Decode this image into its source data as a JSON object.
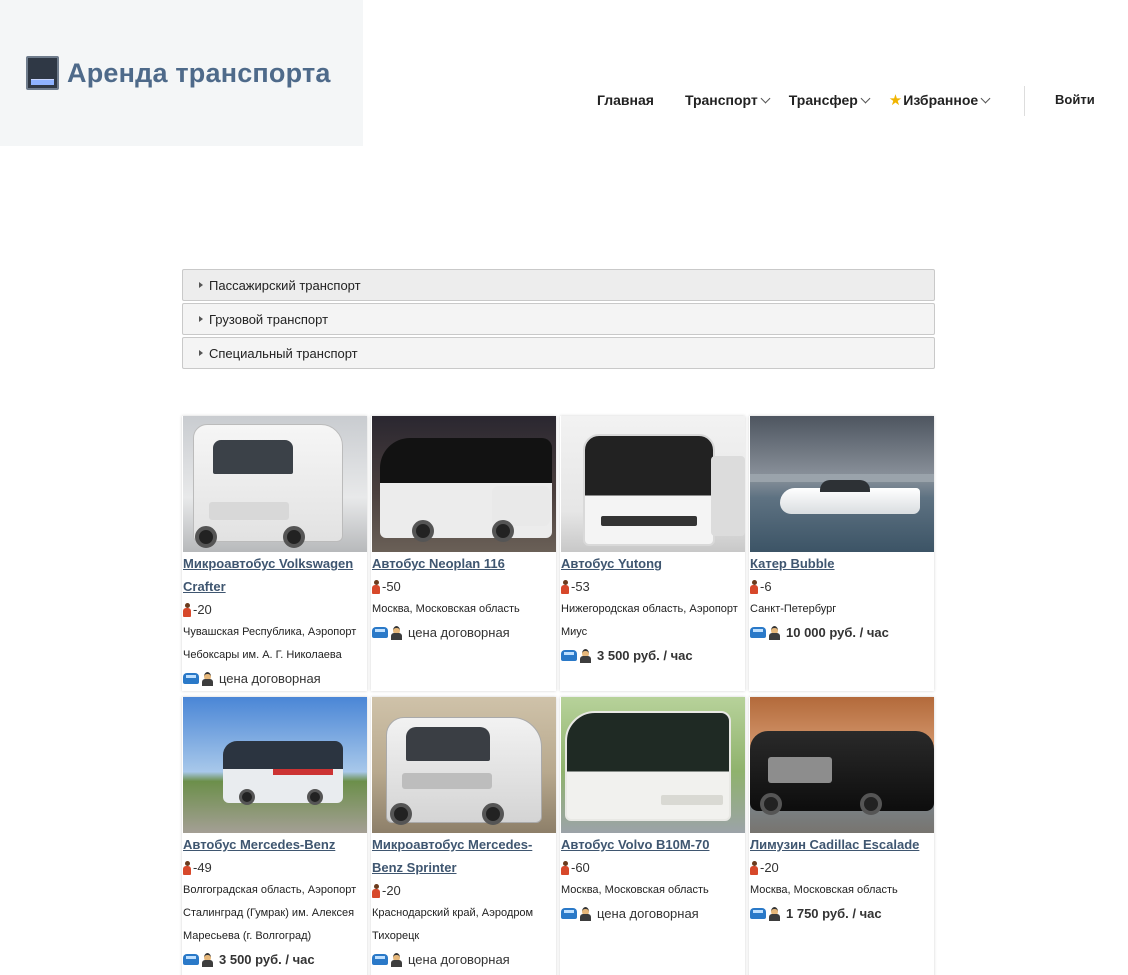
{
  "header": {
    "site_title": "Аренда транспорта",
    "logo_icon": "bus-monitor-icon",
    "nav": [
      {
        "label": "Главная",
        "dropdown": false
      },
      {
        "label": "Транспорт",
        "dropdown": true
      },
      {
        "label": "Трансфер",
        "dropdown": true
      },
      {
        "label": "Избранное",
        "dropdown": true,
        "icon": "star-icon"
      }
    ],
    "login_label": "Войти"
  },
  "accordion": [
    {
      "label": "Пассажирский транспорт"
    },
    {
      "label": "Грузовой транспорт"
    },
    {
      "label": "Специальный транспорт"
    }
  ],
  "listings": [
    {
      "title": "Микроавтобус Volkswagen Crafter",
      "seats": "-20",
      "location": "Чувашская Республика, Аэропорт Чебоксары им. А. Г. Николаева",
      "price": "цена договорная",
      "price_bold": false
    },
    {
      "title": "Автобус Neoplan 116",
      "seats": "-50",
      "location": "Москва, Московская область",
      "price": "цена договорная",
      "price_bold": false
    },
    {
      "title": "Автобус Yutong",
      "seats": "-53",
      "location": "Нижегородская область, Аэропорт Миус",
      "price": "3 500 руб. / час",
      "price_bold": true
    },
    {
      "title": "Катер Bubble",
      "seats": "-6",
      "location": "Санкт-Петербург",
      "price": "10 000 руб. / час",
      "price_bold": true
    },
    {
      "title": "Автобус Mercedes-Benz",
      "seats": "-49",
      "location": "Волгоградская область, Аэропорт Сталинград (Гумрак) им. Алексея Маресьева (г. Волгоград)",
      "price": "3 500 руб. / час",
      "price_bold": true
    },
    {
      "title": "Микроавтобус Mercedes-Benz Sprinter",
      "seats": "-20",
      "location": "Краснодарский край, Аэродром Тихорецк",
      "price": "цена договорная",
      "price_bold": false
    },
    {
      "title": "Автобус Volvo B10M-70",
      "seats": "-60",
      "location": "Москва, Московская область",
      "price": "цена договорная",
      "price_bold": false
    },
    {
      "title": "Лимузин Cadillac Escalade",
      "seats": "-20",
      "location": "Москва, Московская область",
      "price": "1 750 руб. / час",
      "price_bold": true
    }
  ]
}
